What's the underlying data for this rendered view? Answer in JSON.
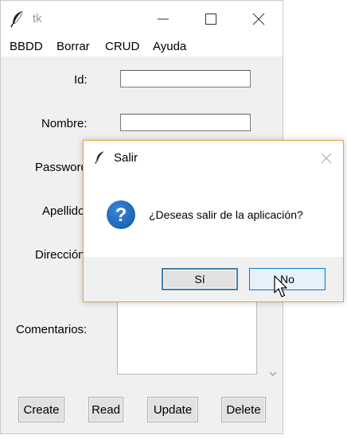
{
  "window": {
    "title": "tk",
    "icons": {
      "app": "feather-icon",
      "minimize": "minimize-icon",
      "maximize": "maximize-icon",
      "close": "close-icon"
    }
  },
  "menubar": {
    "items": [
      {
        "label": "BBDD"
      },
      {
        "label": "Borrar"
      },
      {
        "label": "CRUD"
      },
      {
        "label": "Ayuda"
      }
    ]
  },
  "form": {
    "labels": {
      "id": "Id:",
      "nombre": "Nombre:",
      "password": "Password:",
      "apellido": "Apellido:",
      "direccion": "Dirección:",
      "comentarios": "Comentarios:"
    },
    "values": {
      "id": "",
      "nombre": "",
      "comentarios": ""
    }
  },
  "buttons": {
    "create": "Create",
    "read": "Read",
    "update": "Update",
    "delete": "Delete"
  },
  "dialog": {
    "title": "Salir",
    "message": "¿Deseas salir de la aplicación?",
    "yes_label": "Sí",
    "no_label": "No",
    "icon": "question-icon",
    "accent_color": "#e8a33d",
    "icon_color": "#1a5fb4"
  }
}
